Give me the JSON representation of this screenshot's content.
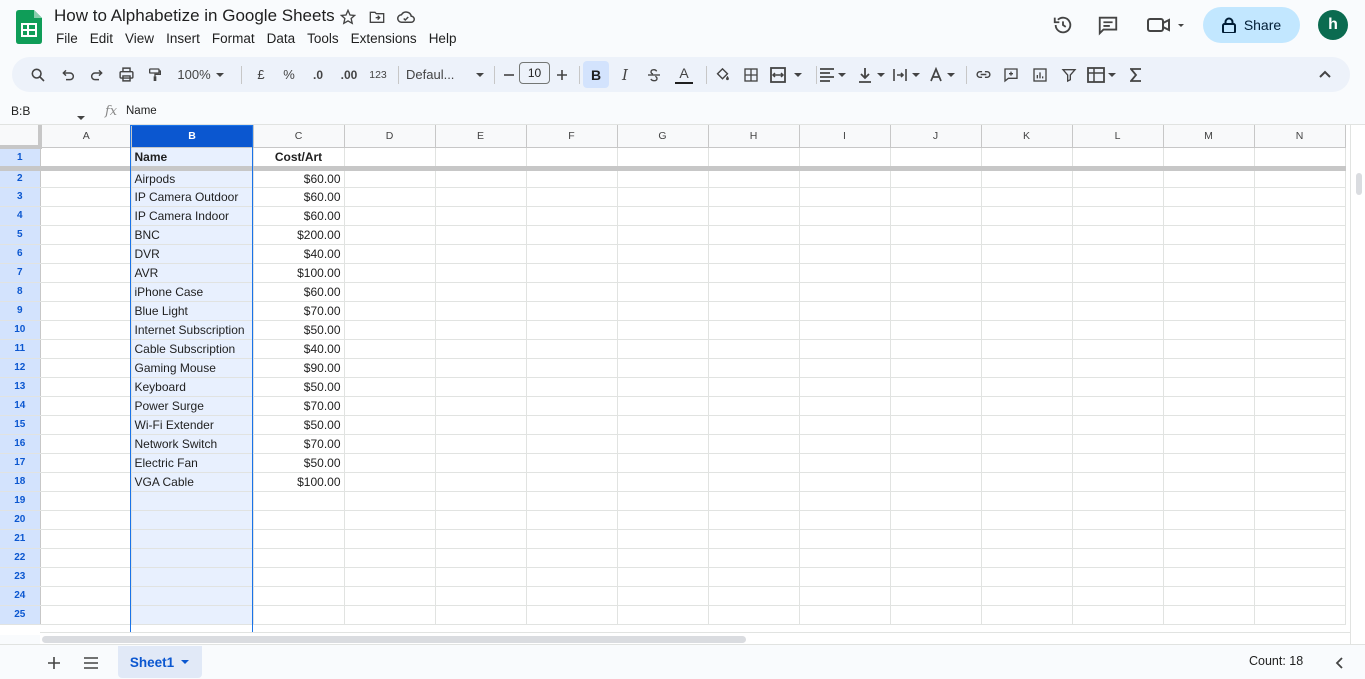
{
  "doc": {
    "title": "How to Alphabetize in Google Sheets"
  },
  "menu": [
    "File",
    "Edit",
    "View",
    "Insert",
    "Format",
    "Data",
    "Tools",
    "Extensions",
    "Help"
  ],
  "share": {
    "label": "Share"
  },
  "avatar": {
    "initial": "h",
    "color": "#0b6b50"
  },
  "toolbar": {
    "zoom": "100%",
    "currency": "£",
    "percent": "%",
    "dec_decrease": ".0",
    "dec_increase": ".00",
    "number_format": "123",
    "font": "Defaul...",
    "font_size": "10",
    "bold": "B",
    "italic": "I",
    "text_color_letter": "A",
    "bold_active": true
  },
  "formula_bar": {
    "name_box": "B:B",
    "fx": "fx",
    "value": "Name"
  },
  "grid": {
    "columns": [
      "A",
      "B",
      "C",
      "D",
      "E",
      "F",
      "G",
      "H",
      "I",
      "J",
      "K",
      "L",
      "M",
      "N"
    ],
    "selected_column": "B",
    "header_row": {
      "b": "Name",
      "c": "Cost/Art"
    },
    "rows": [
      {
        "num": "2",
        "b": "Airpods",
        "c": "$60.00"
      },
      {
        "num": "3",
        "b": "IP Camera Outdoor",
        "c": "$60.00"
      },
      {
        "num": "4",
        "b": "IP Camera Indoor",
        "c": "$60.00"
      },
      {
        "num": "5",
        "b": "BNC",
        "c": "$200.00"
      },
      {
        "num": "6",
        "b": "DVR",
        "c": "$40.00"
      },
      {
        "num": "7",
        "b": "AVR",
        "c": "$100.00"
      },
      {
        "num": "8",
        "b": "iPhone Case",
        "c": "$60.00"
      },
      {
        "num": "9",
        "b": "Blue Light",
        "c": "$70.00"
      },
      {
        "num": "10",
        "b": "Internet Subscription",
        "c": "$50.00"
      },
      {
        "num": "11",
        "b": "Cable Subscription",
        "c": "$40.00"
      },
      {
        "num": "12",
        "b": "Gaming Mouse",
        "c": "$90.00"
      },
      {
        "num": "13",
        "b": "Keyboard",
        "c": "$50.00"
      },
      {
        "num": "14",
        "b": "Power Surge",
        "c": "$70.00"
      },
      {
        "num": "15",
        "b": "Wi-Fi Extender",
        "c": "$50.00"
      },
      {
        "num": "16",
        "b": "Network Switch",
        "c": "$70.00"
      },
      {
        "num": "17",
        "b": "Electric Fan",
        "c": "$50.00"
      },
      {
        "num": "18",
        "b": "VGA Cable",
        "c": "$100.00"
      },
      {
        "num": "19",
        "b": "",
        "c": ""
      },
      {
        "num": "20",
        "b": "",
        "c": ""
      },
      {
        "num": "21",
        "b": "",
        "c": ""
      },
      {
        "num": "22",
        "b": "",
        "c": ""
      },
      {
        "num": "23",
        "b": "",
        "c": ""
      },
      {
        "num": "24",
        "b": "",
        "c": ""
      },
      {
        "num": "25",
        "b": "",
        "c": ""
      }
    ]
  },
  "sheets": [
    {
      "name": "Sheet1",
      "active": true
    }
  ],
  "status": {
    "count": "Count: 18"
  },
  "colors": {
    "accent": "#0b57d0",
    "selection": "#e8f0fe",
    "share_bg": "#c2e7ff",
    "logo": "#0f9d58"
  }
}
